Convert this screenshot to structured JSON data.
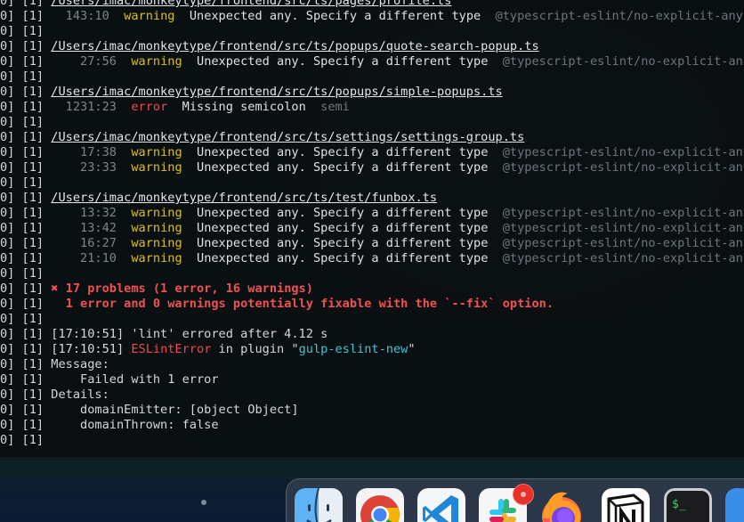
{
  "terminal": {
    "lines": [
      {
        "segments": [
          {
            "t": "0] [1] ",
            "c": "prefix"
          },
          {
            "t": "/Users/imac/monkeytype/frontend/src/ts/pages/profile.ts",
            "c": "path"
          }
        ]
      },
      {
        "segments": [
          {
            "t": "0] [1]   ",
            "c": "prefix"
          },
          {
            "t": "143:10",
            "c": "pos"
          },
          {
            "t": "  warning",
            "c": "warn"
          },
          {
            "t": "  Unexpected any. Specify a different type",
            "c": "msg"
          },
          {
            "t": "  @typescript-eslint/no-explicit-any",
            "c": "rule"
          }
        ]
      },
      {
        "segments": [
          {
            "t": "0] [1]",
            "c": "prefix"
          }
        ]
      },
      {
        "segments": [
          {
            "t": "0] [1] ",
            "c": "prefix"
          },
          {
            "t": "/Users/imac/monkeytype/frontend/src/ts/popups/quote-search-popup.ts",
            "c": "path"
          }
        ]
      },
      {
        "segments": [
          {
            "t": "0] [1]   ",
            "c": "prefix"
          },
          {
            "t": "  27:56",
            "c": "pos"
          },
          {
            "t": "  warning",
            "c": "warn"
          },
          {
            "t": "  Unexpected any. Specify a different type",
            "c": "msg"
          },
          {
            "t": "  @typescript-eslint/no-explicit-any",
            "c": "rule"
          }
        ]
      },
      {
        "segments": [
          {
            "t": "0] [1]",
            "c": "prefix"
          }
        ]
      },
      {
        "segments": [
          {
            "t": "0] [1] ",
            "c": "prefix"
          },
          {
            "t": "/Users/imac/monkeytype/frontend/src/ts/popups/simple-popups.ts",
            "c": "path"
          }
        ]
      },
      {
        "segments": [
          {
            "t": "0] [1]   ",
            "c": "prefix"
          },
          {
            "t": "1231:23",
            "c": "pos"
          },
          {
            "t": "  error",
            "c": "err"
          },
          {
            "t": "  Missing semicolon",
            "c": "msg"
          },
          {
            "t": "  semi",
            "c": "rule"
          }
        ]
      },
      {
        "segments": [
          {
            "t": "0] [1]",
            "c": "prefix"
          }
        ]
      },
      {
        "segments": [
          {
            "t": "0] [1] ",
            "c": "prefix"
          },
          {
            "t": "/Users/imac/monkeytype/frontend/src/ts/settings/settings-group.ts",
            "c": "path"
          }
        ]
      },
      {
        "segments": [
          {
            "t": "0] [1]   ",
            "c": "prefix"
          },
          {
            "t": "  17:38",
            "c": "pos"
          },
          {
            "t": "  warning",
            "c": "warn"
          },
          {
            "t": "  Unexpected any. Specify a different type",
            "c": "msg"
          },
          {
            "t": "  @typescript-eslint/no-explicit-any",
            "c": "rule"
          }
        ]
      },
      {
        "segments": [
          {
            "t": "0] [1]   ",
            "c": "prefix"
          },
          {
            "t": "  23:33",
            "c": "pos"
          },
          {
            "t": "  warning",
            "c": "warn"
          },
          {
            "t": "  Unexpected any. Specify a different type",
            "c": "msg"
          },
          {
            "t": "  @typescript-eslint/no-explicit-any",
            "c": "rule"
          }
        ]
      },
      {
        "segments": [
          {
            "t": "0] [1]",
            "c": "prefix"
          }
        ]
      },
      {
        "segments": [
          {
            "t": "0] [1] ",
            "c": "prefix"
          },
          {
            "t": "/Users/imac/monkeytype/frontend/src/ts/test/funbox.ts",
            "c": "path"
          }
        ]
      },
      {
        "segments": [
          {
            "t": "0] [1]   ",
            "c": "prefix"
          },
          {
            "t": "  13:32",
            "c": "pos"
          },
          {
            "t": "  warning",
            "c": "warn"
          },
          {
            "t": "  Unexpected any. Specify a different type",
            "c": "msg"
          },
          {
            "t": "  @typescript-eslint/no-explicit-any",
            "c": "rule"
          }
        ]
      },
      {
        "segments": [
          {
            "t": "0] [1]   ",
            "c": "prefix"
          },
          {
            "t": "  13:42",
            "c": "pos"
          },
          {
            "t": "  warning",
            "c": "warn"
          },
          {
            "t": "  Unexpected any. Specify a different type",
            "c": "msg"
          },
          {
            "t": "  @typescript-eslint/no-explicit-any",
            "c": "rule"
          }
        ]
      },
      {
        "segments": [
          {
            "t": "0] [1]   ",
            "c": "prefix"
          },
          {
            "t": "  16:27",
            "c": "pos"
          },
          {
            "t": "  warning",
            "c": "warn"
          },
          {
            "t": "  Unexpected any. Specify a different type",
            "c": "msg"
          },
          {
            "t": "  @typescript-eslint/no-explicit-any",
            "c": "rule"
          }
        ]
      },
      {
        "segments": [
          {
            "t": "0] [1]   ",
            "c": "prefix"
          },
          {
            "t": "  21:10",
            "c": "pos"
          },
          {
            "t": "  warning",
            "c": "warn"
          },
          {
            "t": "  Unexpected any. Specify a different type",
            "c": "msg"
          },
          {
            "t": "  @typescript-eslint/no-explicit-any",
            "c": "rule"
          }
        ]
      },
      {
        "segments": [
          {
            "t": "0] [1]",
            "c": "prefix"
          }
        ]
      },
      {
        "segments": [
          {
            "t": "0] [1] ",
            "c": "prefix"
          },
          {
            "t": "✖ 17 problems (1 error, 16 warnings)",
            "c": "summary"
          }
        ]
      },
      {
        "segments": [
          {
            "t": "0] [1]   ",
            "c": "prefix"
          },
          {
            "t": "1 error and 0 warnings potentially fixable with the `--fix` option.",
            "c": "summary"
          }
        ]
      },
      {
        "segments": [
          {
            "t": "0] [1]",
            "c": "prefix"
          }
        ]
      },
      {
        "segments": [
          {
            "t": "0] [1] [17:10:51] 'lint' errored after 4.12 s",
            "c": "prefix"
          }
        ]
      },
      {
        "segments": [
          {
            "t": "0] [1] [17:10:51] ",
            "c": "prefix"
          },
          {
            "t": "ESLintError",
            "c": "red"
          },
          {
            "t": " in plugin \"",
            "c": "prefix"
          },
          {
            "t": "gulp-eslint-new",
            "c": "cyan"
          },
          {
            "t": "\"",
            "c": "prefix"
          }
        ]
      },
      {
        "segments": [
          {
            "t": "0] [1] Message:",
            "c": "prefix"
          }
        ]
      },
      {
        "segments": [
          {
            "t": "0] [1]     Failed with 1 error",
            "c": "prefix"
          }
        ]
      },
      {
        "segments": [
          {
            "t": "0] [1] Details:",
            "c": "prefix"
          }
        ]
      },
      {
        "segments": [
          {
            "t": "0] [1]     domainEmitter: [object Object]",
            "c": "prefix"
          }
        ]
      },
      {
        "segments": [
          {
            "t": "0] [1]     domainThrown: false",
            "c": "prefix"
          }
        ]
      },
      {
        "segments": [
          {
            "t": "0] [1]",
            "c": "prefix"
          }
        ]
      }
    ]
  },
  "dock": {
    "items": [
      {
        "name": "finder-icon",
        "app": "Finder"
      },
      {
        "name": "chrome-icon",
        "app": "Google Chrome"
      },
      {
        "name": "vscode-icon",
        "app": "Visual Studio Code"
      },
      {
        "name": "slack-icon",
        "app": "Slack",
        "badge": true
      },
      {
        "name": "firefox-icon",
        "app": "Firefox"
      },
      {
        "name": "notion-icon",
        "app": "Notion"
      },
      {
        "name": "terminal-icon",
        "app": "Terminal",
        "glyph": "$_"
      }
    ]
  },
  "colors": {
    "warning": "#d9c021",
    "error": "#ef4b4b",
    "rule": "#6e767d",
    "link": "#3cc5d6"
  }
}
